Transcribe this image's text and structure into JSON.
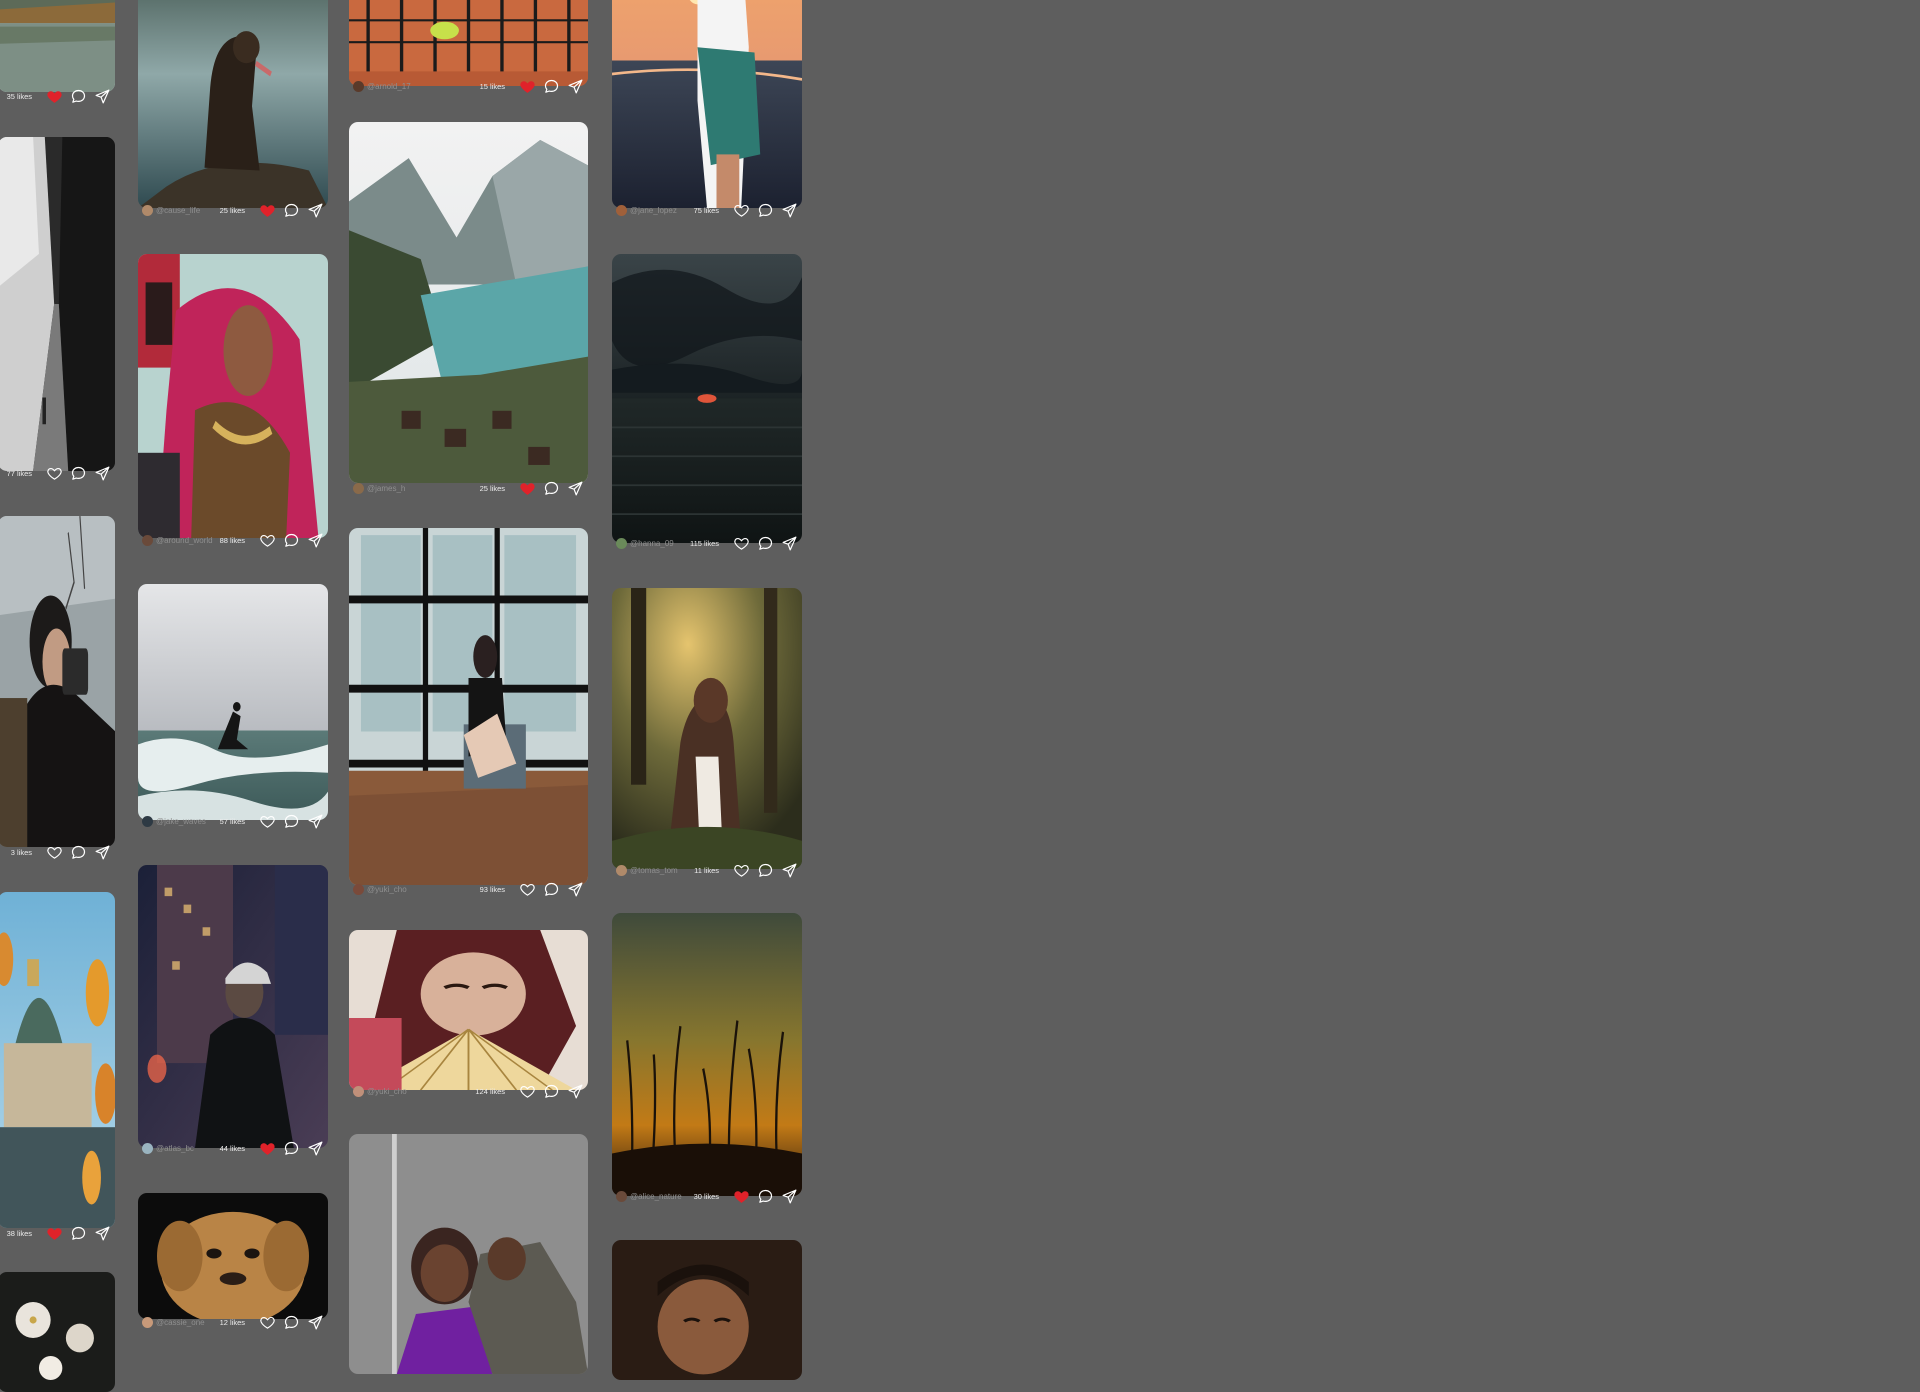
{
  "columns": [
    {
      "cards": [
        {
          "photo": "lake-mountain-reflection",
          "likes": "35 likes",
          "liked": true
        },
        {
          "photo": "black-white-alley",
          "likes": "77 likes",
          "liked": false
        },
        {
          "photo": "bearded-photographer",
          "likes": "3 likes",
          "liked": false
        },
        {
          "photo": "paris-dome-autumn",
          "likes": "38 likes",
          "liked": true
        },
        {
          "photo": "white-blossoms",
          "likes": "",
          "liked": false
        }
      ]
    },
    {
      "cards": [
        {
          "photo": "dog-on-rock-lake",
          "user": "@cause_life",
          "likes": "25 likes",
          "liked": true
        },
        {
          "photo": "woman-pink-saree",
          "user": "@around_world",
          "likes": "88 likes",
          "liked": false
        },
        {
          "photo": "surfer-waves",
          "user": "@jake_waves",
          "likes": "57 likes",
          "liked": false
        },
        {
          "photo": "man-cap-night-city",
          "user": "@atlas_bc",
          "likes": "44 likes",
          "liked": true
        },
        {
          "photo": "golden-dog-portrait",
          "user": "@cassie_one",
          "likes": "12 likes",
          "liked": false
        }
      ]
    },
    {
      "cards": [
        {
          "photo": "tennis-net-ball",
          "user": "@arnold_17",
          "likes": "15 likes",
          "liked": true
        },
        {
          "photo": "fjord-lake-valley",
          "user": "@james_h",
          "likes": "25 likes",
          "liked": true
        },
        {
          "photo": "woman-window-chair",
          "user": "@yuki_cho",
          "likes": "93 likes",
          "liked": false
        },
        {
          "photo": "woman-fan-portrait",
          "user": "@yuki_cho",
          "likes": "124 likes",
          "liked": false
        },
        {
          "photo": "smiling-couple",
          "user": "",
          "likes": "",
          "liked": false
        }
      ]
    },
    {
      "cards": [
        {
          "photo": "woman-sunset-sea",
          "user": "@jane_lopez",
          "likes": "75 likes",
          "liked": false
        },
        {
          "photo": "dark-sunset-ocean",
          "user": "@hanna_09",
          "likes": "115 likes",
          "liked": false
        },
        {
          "photo": "border-collie-forest",
          "user": "@tomas_tom",
          "likes": "11 likes",
          "liked": false
        },
        {
          "photo": "golden-grass-sunset",
          "user": "@alice_nature",
          "likes": "30 likes",
          "liked": true
        },
        {
          "photo": "man-dark-portrait",
          "user": "",
          "likes": "",
          "liked": false
        }
      ]
    }
  ],
  "colors": {
    "background": "#5e5e5e",
    "liked": "#e0222a",
    "icon": "#ffffff"
  }
}
